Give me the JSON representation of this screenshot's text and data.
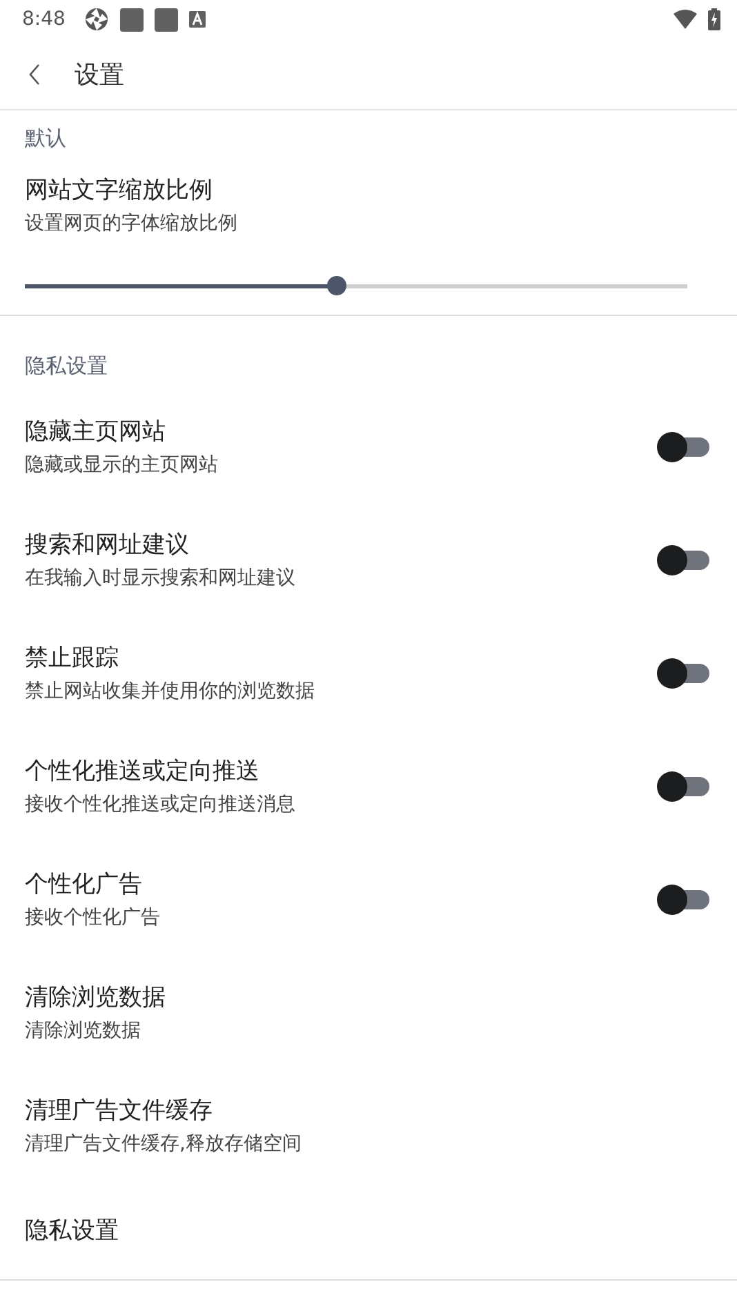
{
  "status_bar": {
    "time": "8:48"
  },
  "app_bar": {
    "title": "设置"
  },
  "sections": [
    {
      "title": "默认",
      "items": [
        {
          "kind": "slider",
          "title": "网站文字缩放比例",
          "subtitle": "设置网页的字体缩放比例",
          "level": 0.47
        }
      ]
    },
    {
      "title": "隐私设置",
      "items": [
        {
          "kind": "switch",
          "title": "隐藏主页网站",
          "subtitle": "隐藏或显示的主页网站",
          "on": false
        },
        {
          "kind": "switch",
          "title": "搜索和网址建议",
          "subtitle": "在我输入时显示搜索和网址建议",
          "on": false
        },
        {
          "kind": "switch",
          "title": "禁止跟踪",
          "subtitle": "禁止网站收集并使用你的浏览数据",
          "on": false
        },
        {
          "kind": "switch",
          "title": "个性化推送或定向推送",
          "subtitle": "接收个性化推送或定向推送消息",
          "on": false
        },
        {
          "kind": "switch",
          "title": "个性化广告",
          "subtitle": "接收个性化广告",
          "on": false
        },
        {
          "kind": "plain",
          "title": "清除浏览数据",
          "subtitle": "清除浏览数据"
        },
        {
          "kind": "plain",
          "title": "清理广告文件缓存",
          "subtitle": "清理广告文件缓存,释放存储空间"
        },
        {
          "kind": "plain",
          "title": "隐私设置"
        }
      ]
    }
  ]
}
